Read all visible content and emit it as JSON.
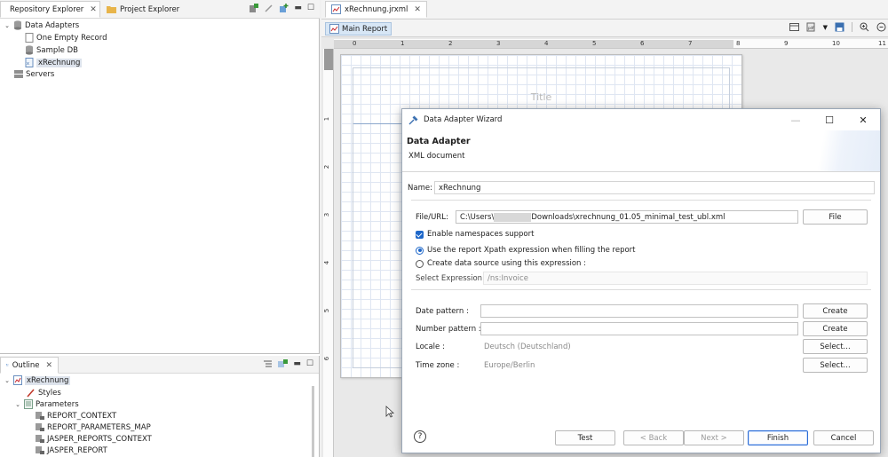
{
  "left": {
    "tabs": [
      {
        "label": "Repository Explorer",
        "close": "✕"
      },
      {
        "label": "Project Explorer"
      }
    ],
    "tree": [
      {
        "label": "Data Adapters",
        "expanded": true
      },
      {
        "label": "One Empty Record"
      },
      {
        "label": "Sample DB"
      },
      {
        "label": "xRechnung",
        "selected": true
      },
      {
        "label": "Servers"
      }
    ],
    "outline": {
      "tab": "Outline",
      "close": "✕",
      "items": [
        {
          "label": "xRechnung",
          "selected": true
        },
        {
          "label": "Styles"
        },
        {
          "label": "Parameters"
        },
        {
          "label": "REPORT_CONTEXT"
        },
        {
          "label": "REPORT_PARAMETERS_MAP"
        },
        {
          "label": "JASPER_REPORTS_CONTEXT"
        },
        {
          "label": "JASPER_REPORT"
        }
      ]
    }
  },
  "editor": {
    "tab": "xRechnung.jrxml",
    "close": "✕",
    "main_report": "Main Report",
    "ruler_h": [
      "0",
      "1",
      "2",
      "3",
      "4",
      "5",
      "6",
      "7",
      "8",
      "9",
      "10",
      "11"
    ],
    "ruler_v": [
      "1",
      "2",
      "3",
      "4",
      "5",
      "6"
    ],
    "title_band": "Title"
  },
  "dialog": {
    "title": "Data Adapter Wizard",
    "heading": "Data Adapter",
    "subheading": "XML document",
    "name_label": "Name:",
    "name_value": "xRechnung",
    "file_label": "File/URL:",
    "file_value_prefix": "C:\\Users\\",
    "file_value_suffix": "Downloads\\xrechnung_01.05_minimal_test_ubl.xml",
    "file_button": "File",
    "enable_ns": "Enable namespaces support",
    "radio_xpath": "Use the report Xpath expression when filling the report",
    "radio_create": "Create data source using this expression :",
    "select_expr_label": "Select Expression :",
    "select_expr_value": "/ns:Invoice",
    "date_pattern_label": "Date pattern :",
    "number_pattern_label": "Number pattern :",
    "locale_label": "Locale :",
    "locale_value": "Deutsch (Deutschland)",
    "timezone_label": "Time zone :",
    "timezone_value": "Europe/Berlin",
    "create_label": "Create",
    "select_label": "Select...",
    "buttons": {
      "help": "?",
      "test": "Test",
      "back": "< Back",
      "next": "Next >",
      "finish": "Finish",
      "cancel": "Cancel"
    },
    "win": {
      "min": "—",
      "max": "☐",
      "close": "✕"
    }
  },
  "colors": {
    "accent": "#1e67c9",
    "finish_border": "#2b6cd6",
    "selection": "#dde3ec"
  }
}
